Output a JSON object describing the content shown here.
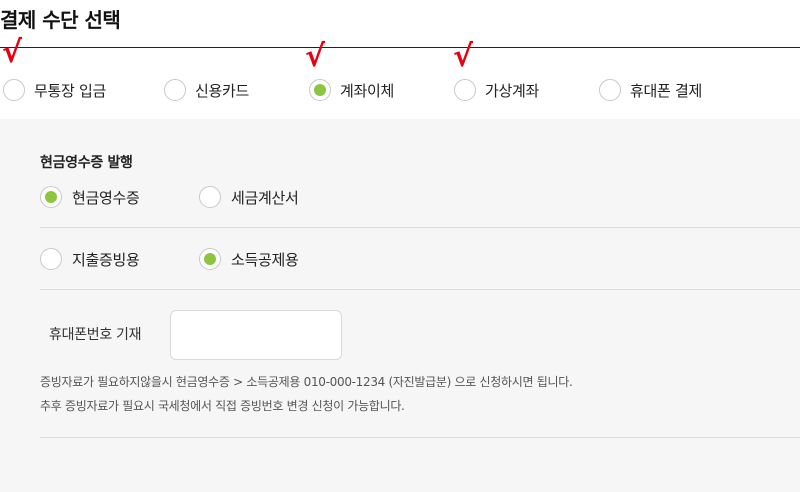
{
  "header": {
    "title": "결제 수단 선택"
  },
  "payment_methods": {
    "options": [
      {
        "label": "무통장 입금",
        "checked": false
      },
      {
        "label": "신용카드",
        "checked": false
      },
      {
        "label": "계좌이체",
        "checked": true
      },
      {
        "label": "가상계좌",
        "checked": false
      },
      {
        "label": "휴대폰 결제",
        "checked": false
      }
    ],
    "annotation_mark": "√"
  },
  "receipt": {
    "section_title": "현금영수증 발행",
    "type_options": [
      {
        "label": "현금영수증",
        "checked": true
      },
      {
        "label": "세금계산서",
        "checked": false
      }
    ],
    "purpose_options": [
      {
        "label": "지출증빙용",
        "checked": false
      },
      {
        "label": "소득공제용",
        "checked": true
      }
    ],
    "phone": {
      "label": "휴대폰번호 기재",
      "value": "",
      "placeholder": ""
    },
    "notes": [
      "증빙자료가 필요하지않을시 현금영수증 > 소득공제용 010-000-1234 (자진발급분) 으로 신청하시면 됩니다.",
      "추후 증빙자료가 필요시 국세청에서 직접 증빙번호 변경 신청이 가능합니다."
    ]
  },
  "colors": {
    "accent": "#8cc63f",
    "annotation": "#e60012",
    "panel": "#f6f6f6"
  }
}
